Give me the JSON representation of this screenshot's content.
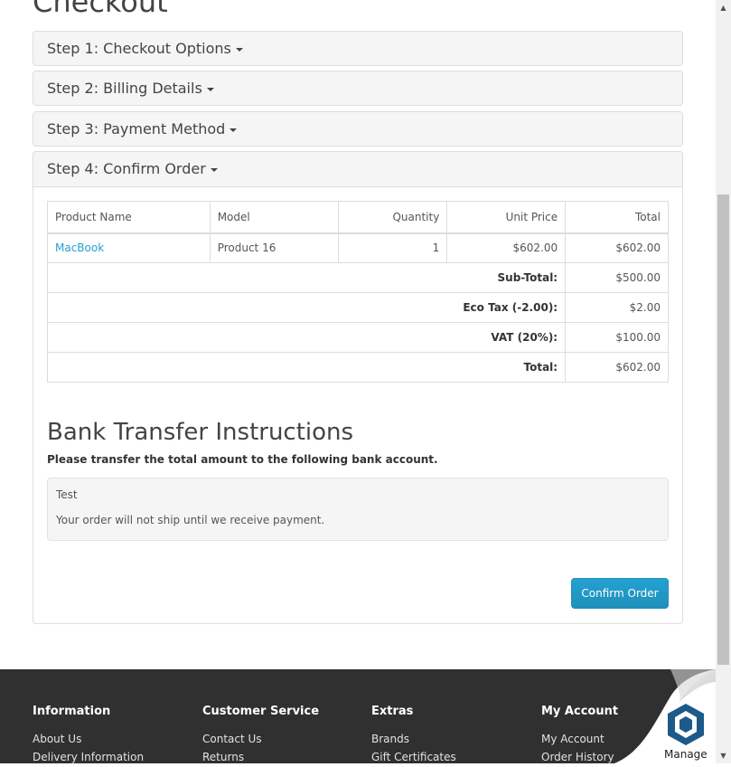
{
  "page": {
    "title": "Checkout"
  },
  "steps": [
    {
      "label": "Step 1: Checkout Options"
    },
    {
      "label": "Step 2: Billing Details"
    },
    {
      "label": "Step 3: Payment Method"
    },
    {
      "label": "Step 4: Confirm Order"
    }
  ],
  "cart": {
    "headers": [
      "Product Name",
      "Model",
      "Quantity",
      "Unit Price",
      "Total"
    ],
    "rows": [
      {
        "name": "MacBook",
        "model": "Product 16",
        "quantity": "1",
        "unit_price": "$602.00",
        "total": "$602.00"
      }
    ],
    "totals": [
      {
        "label": "Sub-Total:",
        "value": "$500.00"
      },
      {
        "label": "Eco Tax (-2.00):",
        "value": "$2.00"
      },
      {
        "label": "VAT (20%):",
        "value": "$100.00"
      },
      {
        "label": "Total:",
        "value": "$602.00"
      }
    ]
  },
  "bank": {
    "title": "Bank Transfer Instructions",
    "note": "Please transfer the total amount to the following bank account.",
    "details": "Test",
    "warning": "Your order will not ship until we receive payment."
  },
  "confirm_label": "Confirm Order",
  "footer": {
    "columns": [
      {
        "heading": "Information",
        "links": [
          "About Us",
          "Delivery Information"
        ]
      },
      {
        "heading": "Customer Service",
        "links": [
          "Contact Us",
          "Returns"
        ]
      },
      {
        "heading": "Extras",
        "links": [
          "Brands",
          "Gift Certificates"
        ]
      },
      {
        "heading": "My Account",
        "links": [
          "My Account",
          "Order History"
        ]
      }
    ]
  },
  "manage_widget": {
    "label": "Manage",
    "icon": "bitnami-hexagon-icon"
  },
  "colors": {
    "accent": "#23a1d1",
    "footer_bg": "#303030",
    "panel_heading_bg": "#f5f5f5"
  }
}
